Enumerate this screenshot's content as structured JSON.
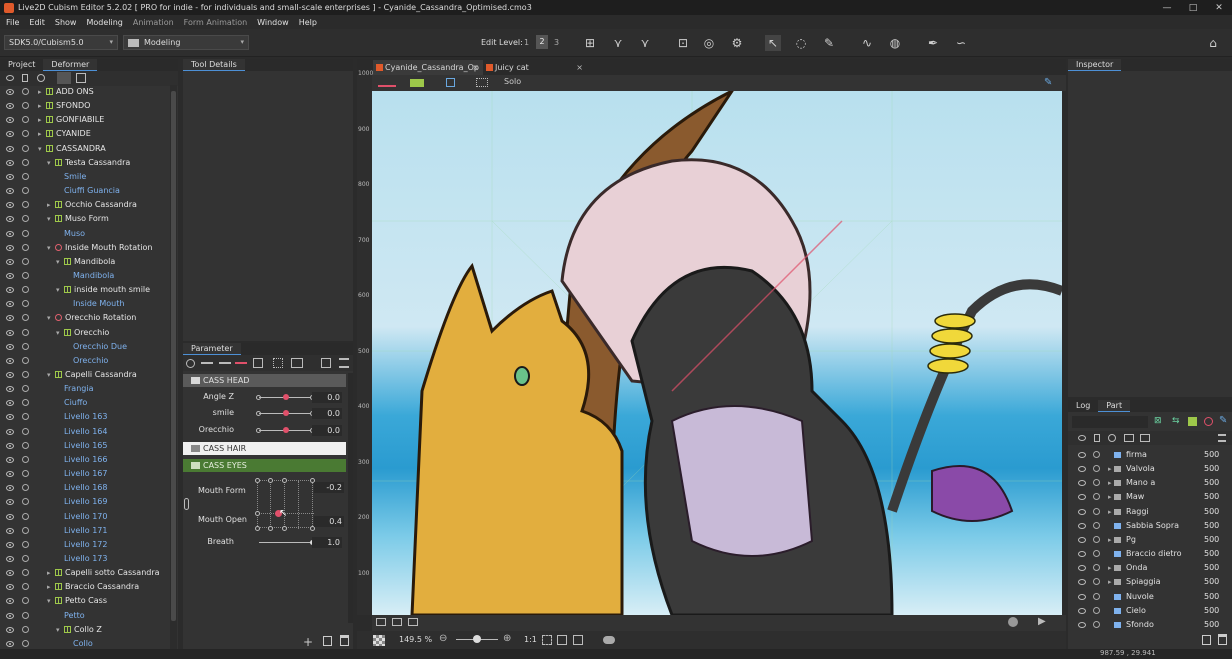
{
  "window": {
    "title": "Live2D Cubism Editor 5.2.02   [ PRO for indie - for individuals and small-scale enterprises ]  - Cyanide_Cassandra_Optimised.cmo3",
    "controls": [
      "—",
      "□",
      "✕"
    ]
  },
  "menu": {
    "items": [
      "File",
      "Edit",
      "Show",
      "Modeling",
      "Animation",
      "Form Animation",
      "Window",
      "Help"
    ]
  },
  "toolbar": {
    "sdk_select": "SDK5.0/Cubism5.0",
    "mode_select": "Modeling",
    "edit_level_label": "Edit Level:",
    "edit_levels": [
      "1",
      "2",
      "3"
    ],
    "active_edit_level": "2"
  },
  "left_panel": {
    "tabs": [
      "Project",
      "Deformer"
    ],
    "active_tab": "Deformer",
    "tree": [
      {
        "label": "ADD ONS",
        "kind": "grid",
        "indent": 0,
        "arrow": "▸"
      },
      {
        "label": "SFONDO",
        "kind": "grid",
        "indent": 0,
        "arrow": "▸"
      },
      {
        "label": "GONFIABILE",
        "kind": "grid",
        "indent": 0,
        "arrow": "▸"
      },
      {
        "label": "CYANIDE",
        "kind": "grid",
        "indent": 0,
        "arrow": "▸"
      },
      {
        "label": "CASSANDRA",
        "kind": "grid",
        "indent": 0,
        "arrow": "▾"
      },
      {
        "label": "Testa Cassandra",
        "kind": "grid",
        "indent": 1,
        "arrow": "▾"
      },
      {
        "label": "Smile",
        "kind": "art",
        "indent": 2,
        "arrow": ""
      },
      {
        "label": "Ciuffi Guancia",
        "kind": "art",
        "indent": 2,
        "arrow": ""
      },
      {
        "label": "Occhio Cassandra",
        "kind": "grid",
        "indent": 1,
        "arrow": "▸"
      },
      {
        "label": "Muso Form",
        "kind": "grid",
        "indent": 1,
        "arrow": "▾"
      },
      {
        "label": "Muso",
        "kind": "art",
        "indent": 2,
        "arrow": ""
      },
      {
        "label": "Inside Mouth Rotation",
        "kind": "rot",
        "indent": 1,
        "arrow": "▾"
      },
      {
        "label": "Mandibola",
        "kind": "grid",
        "indent": 2,
        "arrow": "▾"
      },
      {
        "label": "Mandibola",
        "kind": "art",
        "indent": 3,
        "arrow": ""
      },
      {
        "label": "inside mouth smile",
        "kind": "grid",
        "indent": 2,
        "arrow": "▾"
      },
      {
        "label": "Inside Mouth",
        "kind": "art",
        "indent": 3,
        "arrow": ""
      },
      {
        "label": "Orecchio Rotation",
        "kind": "rot",
        "indent": 1,
        "arrow": "▾"
      },
      {
        "label": "Orecchio",
        "kind": "grid",
        "indent": 2,
        "arrow": "▾"
      },
      {
        "label": "Orecchio Due",
        "kind": "art",
        "indent": 3,
        "arrow": ""
      },
      {
        "label": "Orecchio",
        "kind": "art",
        "indent": 3,
        "arrow": ""
      },
      {
        "label": "Capelli Cassandra",
        "kind": "grid",
        "indent": 1,
        "arrow": "▾"
      },
      {
        "label": "Frangia",
        "kind": "art",
        "indent": 2,
        "arrow": ""
      },
      {
        "label": "Ciuffo",
        "kind": "art",
        "indent": 2,
        "arrow": ""
      },
      {
        "label": "Livello 163",
        "kind": "art",
        "indent": 2,
        "arrow": ""
      },
      {
        "label": "Livello 164",
        "kind": "art",
        "indent": 2,
        "arrow": ""
      },
      {
        "label": "Livello 165",
        "kind": "art",
        "indent": 2,
        "arrow": ""
      },
      {
        "label": "Livello 166",
        "kind": "art",
        "indent": 2,
        "arrow": ""
      },
      {
        "label": "Livello 167",
        "kind": "art",
        "indent": 2,
        "arrow": ""
      },
      {
        "label": "Livello 168",
        "kind": "art",
        "indent": 2,
        "arrow": ""
      },
      {
        "label": "Livello 169",
        "kind": "art",
        "indent": 2,
        "arrow": ""
      },
      {
        "label": "Livello 170",
        "kind": "art",
        "indent": 2,
        "arrow": ""
      },
      {
        "label": "Livello 171",
        "kind": "art",
        "indent": 2,
        "arrow": ""
      },
      {
        "label": "Livello 172",
        "kind": "art",
        "indent": 2,
        "arrow": ""
      },
      {
        "label": "Livello 173",
        "kind": "art",
        "indent": 2,
        "arrow": ""
      },
      {
        "label": "Capelli sotto Cassandra",
        "kind": "grid",
        "indent": 1,
        "arrow": "▸"
      },
      {
        "label": "Braccio Cassandra",
        "kind": "grid",
        "indent": 1,
        "arrow": "▸"
      },
      {
        "label": "Petto Cass",
        "kind": "grid",
        "indent": 1,
        "arrow": "▾"
      },
      {
        "label": "Petto",
        "kind": "art",
        "indent": 2,
        "arrow": ""
      },
      {
        "label": "Collo Z",
        "kind": "grid",
        "indent": 2,
        "arrow": "▾"
      },
      {
        "label": "Collo",
        "kind": "art",
        "indent": 3,
        "arrow": ""
      }
    ]
  },
  "tool_details": {
    "tab": "Tool Details"
  },
  "parameter_panel": {
    "tab": "Parameter",
    "groups": {
      "head": "CASS HEAD",
      "hair": "CASS HAIR",
      "eyes": "CASS EYES"
    },
    "params": [
      {
        "label": "Angle Z",
        "value": "0.0",
        "fraction": 0.5
      },
      {
        "label": "smile",
        "value": "0.0",
        "fraction": 0.5
      },
      {
        "label": "Orecchio",
        "value": "0.0",
        "fraction": 0.5
      },
      {
        "label": "Mouth Form",
        "value": "-0.2",
        "fraction": 0.4
      },
      {
        "label": "Mouth Open",
        "value": "0.4",
        "fraction": 0.4
      },
      {
        "label": "Breath",
        "value": "1.0",
        "fraction": 1.0
      }
    ]
  },
  "canvas": {
    "tabs": [
      {
        "label": "Cyanide_Cassandra_Op",
        "active": true
      },
      {
        "label": "Juicy cat",
        "active": false
      }
    ],
    "solo_label": "Solo",
    "ruler": [
      "1000",
      "900",
      "800",
      "700",
      "600",
      "500",
      "400",
      "300",
      "200",
      "100"
    ],
    "zoom": "149.5 %",
    "one_to_one": "1:1"
  },
  "inspector": {
    "tab": "Inspector"
  },
  "part_panel": {
    "tabs": [
      "Log",
      "Part"
    ],
    "active_tab": "Part",
    "rows": [
      {
        "name": "firma",
        "value": "500",
        "arrow": ""
      },
      {
        "name": "Valvola",
        "value": "500",
        "arrow": "▸"
      },
      {
        "name": "Mano a",
        "value": "500",
        "arrow": "▸"
      },
      {
        "name": "Maw",
        "value": "500",
        "arrow": "▸"
      },
      {
        "name": "Raggi",
        "value": "500",
        "arrow": "▸"
      },
      {
        "name": "Sabbia Sopra",
        "value": "500",
        "arrow": ""
      },
      {
        "name": "Pg",
        "value": "500",
        "arrow": "▸"
      },
      {
        "name": "Braccio dietro",
        "value": "500",
        "arrow": ""
      },
      {
        "name": "Onda",
        "value": "500",
        "arrow": "▸"
      },
      {
        "name": "Spiaggia",
        "value": "500",
        "arrow": "▸"
      },
      {
        "name": "Nuvole",
        "value": "500",
        "arrow": ""
      },
      {
        "name": "Cielo",
        "value": "500",
        "arrow": ""
      },
      {
        "name": "Sfondo",
        "value": "500",
        "arrow": ""
      }
    ]
  },
  "status": {
    "coords": "987.59 , 29.941"
  },
  "colors": {
    "accent": "#4d90d6",
    "active_group": "#4a7a33",
    "knob": "#e0506a"
  }
}
